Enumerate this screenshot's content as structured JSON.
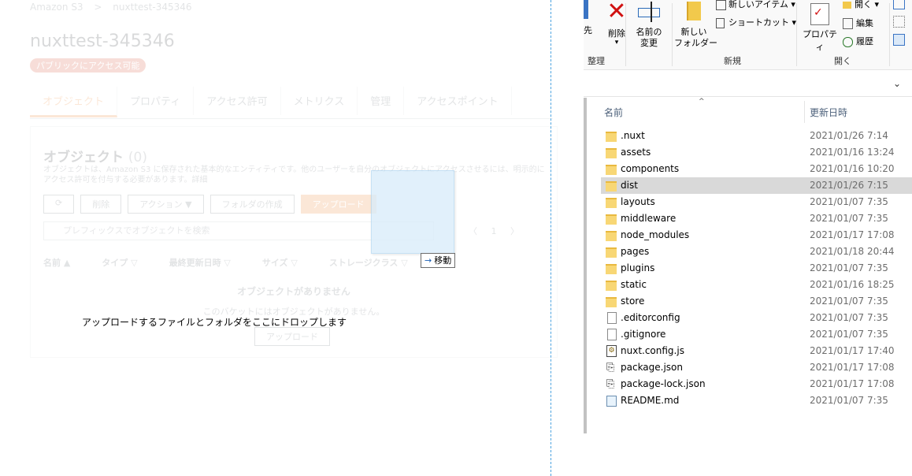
{
  "s3": {
    "breadcrumb": [
      "Amazon S3",
      ">",
      "nuxttest-345346"
    ],
    "bucket_title": "nuxttest-345346",
    "public_badge": "パブリックにアクセス可能",
    "tabs": [
      "オブジェクト",
      "プロパティ",
      "アクセス許可",
      "メトリクス",
      "管理",
      "アクセスポイント"
    ],
    "panel_title": "オブジェクト",
    "panel_count": "(0)",
    "panel_desc": "オブジェクトは、Amazon S3 に保存された基本的なエンティティです。他のユーザーを自分のオブジェクトにアクセスさせるには、明示的にアクセス許可を付与する必要があります。詳細",
    "buttons": {
      "refresh": "⟳",
      "delete": "削除",
      "actions": "アクション ▼",
      "create_folder": "フォルダの作成",
      "upload": "アップロード"
    },
    "search_placeholder": "プレフィックスでオブジェクトを検索",
    "pager": "〈 1 〉",
    "columns": [
      "名前 ▲",
      "タイプ ▽",
      "最終更新日時 ▽",
      "サイズ ▽",
      "ストレージクラス ▽"
    ],
    "empty_title": "オブジェクトがありません",
    "empty_desc": "このバケットにはオブジェクトがありません。",
    "empty_upload": "アップロード",
    "drop_message": "アップロードするファイルとフォルダをここにドロップします",
    "drag_tooltip_icon": "arrow-right-icon",
    "drag_tooltip": "移動"
  },
  "explorer": {
    "ribbon": {
      "partial_label": "先",
      "delete_label": "削除",
      "delete_sub": "▾",
      "rename_label": "名前の\n変更",
      "new_folder_label": "新しい\nフォルダー",
      "new_item": "新しいアイテム ▾",
      "shortcut": "ショートカット ▾",
      "properties": "プロパティ",
      "open": "開く ▾",
      "edit": "編集",
      "history": "履歴",
      "groups": [
        "整理",
        "新規",
        "開く"
      ]
    },
    "address_chevron": "⌄",
    "columns": {
      "name": "名前",
      "modified": "更新日時",
      "sort_arrow": "^"
    },
    "files": [
      {
        "name": ".nuxt",
        "date": "2021/01/26 7:14",
        "type": "folder"
      },
      {
        "name": "assets",
        "date": "2021/01/16 13:24",
        "type": "folder"
      },
      {
        "name": "components",
        "date": "2021/01/16 10:20",
        "type": "folder"
      },
      {
        "name": "dist",
        "date": "2021/01/26 7:15",
        "type": "folder",
        "selected": true
      },
      {
        "name": "layouts",
        "date": "2021/01/07 7:35",
        "type": "folder"
      },
      {
        "name": "middleware",
        "date": "2021/01/07 7:35",
        "type": "folder"
      },
      {
        "name": "node_modules",
        "date": "2021/01/17 17:08",
        "type": "folder"
      },
      {
        "name": "pages",
        "date": "2021/01/18 20:44",
        "type": "folder"
      },
      {
        "name": "plugins",
        "date": "2021/01/07 7:35",
        "type": "folder"
      },
      {
        "name": "static",
        "date": "2021/01/16 18:25",
        "type": "folder"
      },
      {
        "name": "store",
        "date": "2021/01/07 7:35",
        "type": "folder"
      },
      {
        "name": ".editorconfig",
        "date": "2021/01/07 7:35",
        "type": "file"
      },
      {
        "name": ".gitignore",
        "date": "2021/01/07 7:35",
        "type": "file"
      },
      {
        "name": "nuxt.config.js",
        "date": "2021/01/17 17:40",
        "type": "js"
      },
      {
        "name": "package.json",
        "date": "2021/01/17 17:08",
        "type": "json"
      },
      {
        "name": "package-lock.json",
        "date": "2021/01/17 17:08",
        "type": "json"
      },
      {
        "name": "README.md",
        "date": "2021/01/07 7:35",
        "type": "md"
      }
    ]
  }
}
